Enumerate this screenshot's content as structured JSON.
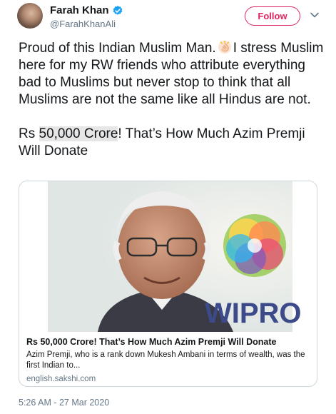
{
  "author": {
    "display_name": "Farah Khan",
    "handle": "@FarahKhanAli"
  },
  "follow_label": "Follow",
  "tweet": {
    "para1_a": "Proud of this Indian Muslim Man.",
    "para1_b": "I stress Muslim here for my RW friends who attribute everything bad to Muslims but never stop to think that all Muslims are not the same like all Hindus are not.",
    "para2_a": "Rs ",
    "para2_highlight": "50,000 Crore",
    "para2_b": "! That’s How Much Azim Premji Will Donate"
  },
  "card": {
    "image_text": "WIPRO",
    "title": "Rs 50,000 Crore! That’s How Much Azim Premji Will Donate",
    "description": "Azim Premji, who is a rank down Mukesh Ambani in terms of wealth, was the first Indian to...",
    "domain": "english.sakshi.com"
  },
  "timestamp": "5:26 AM - 27 Mar 2020",
  "colors": {
    "follow": "#e0245e",
    "verified": "#1da1f2",
    "secondary_text": "#657786"
  }
}
